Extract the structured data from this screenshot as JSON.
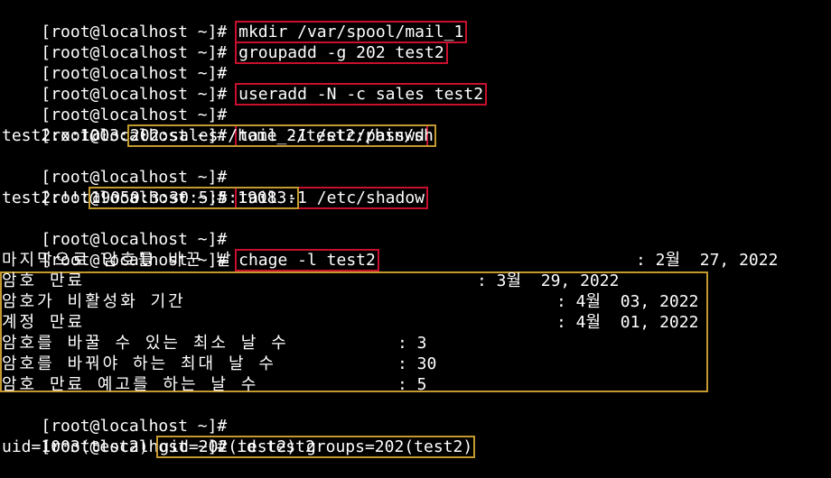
{
  "prompt": "[root@localhost ~]#",
  "lines": [
    {
      "cmd": "mkdir /var/spool/mail_1",
      "boxed": "red"
    },
    {
      "cmd": "groupadd -g 202 test2",
      "boxed": "red"
    },
    {
      "cmd": ""
    },
    {
      "cmd": "useradd -N -c sales test2",
      "boxed": "red"
    },
    {
      "cmd": ""
    },
    {
      "cmd": "tail -1 /etc/passwd",
      "boxed": "red"
    },
    {
      "out_prefix": "test2:x:1003:",
      "out_box": "202:sales:/home_2/test2:/bin/sh"
    },
    {
      "cmd": ""
    },
    {
      "cmd": "tail -1 /etc/shadow",
      "boxed": "red"
    },
    {
      "out_prefix": "test2:!!:",
      "out_box": "19050:3:30:5:5:19083:"
    },
    {
      "cmd": ""
    },
    {
      "cmd": "chage -l test2",
      "boxed": "red"
    }
  ],
  "chage": {
    "last_change_label": "마지막으로 암호를 바꾼 날",
    "last_change_value": ": 2월  27, 2022",
    "rows": [
      {
        "label": "암호 만료",
        "value": ": 3월  29, 2022"
      },
      {
        "label": "암호가 비활성화 기간",
        "value": ": 4월  03, 2022"
      },
      {
        "label": "계정 만료",
        "value": ": 4월  01, 2022"
      },
      {
        "label": "암호를 바꿀 수 있는 최소 날 수",
        "value": ": 3"
      },
      {
        "label": "암호를 바꿔야 하는 최대 날 수",
        "value": ": 30"
      },
      {
        "label": "암호 만료 예고를 하는 날 수",
        "value": ": 5"
      }
    ]
  },
  "tail_lines": [
    {
      "cmd": ""
    },
    {
      "cmd": "id test2"
    }
  ],
  "id_output": {
    "prefix": "uid=1003(test2) ",
    "boxed": "gid=202(test2) groups=202(test2)"
  },
  "colors": {
    "background": "#000000",
    "text": "#ffffff",
    "command_box": "#c8102e",
    "output_box": "#c49a30"
  }
}
